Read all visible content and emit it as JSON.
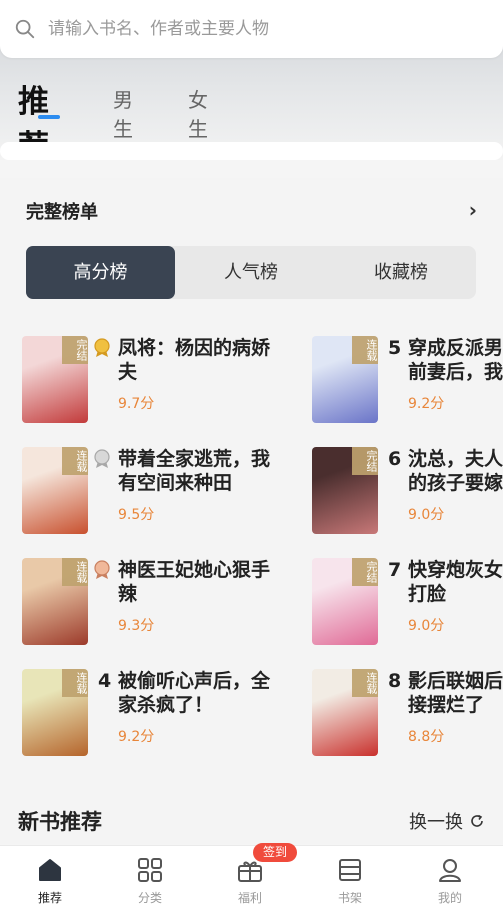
{
  "search": {
    "placeholder": "请输入书名、作者或主要人物"
  },
  "top_tabs": [
    "推荐",
    "男生",
    "女生"
  ],
  "ranking": {
    "title": "完整榜单",
    "segments": [
      "高分榜",
      "人气榜",
      "收藏榜"
    ],
    "books": [
      {
        "rank": "1",
        "title": "凤将：杨因的病娇\n夫",
        "score": "9.7分",
        "status": "完结",
        "medal": "gold",
        "cover_colors": [
          "#f3d7d7",
          "#c23a3a"
        ]
      },
      {
        "rank": "2",
        "title": "带着全家逃荒，我\n有空间来种田",
        "score": "9.5分",
        "status": "连载",
        "medal": "silver",
        "cover_colors": [
          "#f5e6dc",
          "#c8502e"
        ]
      },
      {
        "rank": "3",
        "title": "神医王妃她心狠手\n辣",
        "score": "9.3分",
        "status": "连载",
        "medal": "bronze",
        "cover_colors": [
          "#e9c9a8",
          "#9c3a2a"
        ]
      },
      {
        "rank": "4",
        "title": "被偷听心声后，全\n家杀疯了！",
        "score": "9.2分",
        "status": "连载",
        "medal": "",
        "cover_colors": [
          "#e8e5b8",
          "#b5642b"
        ]
      },
      {
        "rank": "5",
        "title": "穿成反派男\n前妻后，我",
        "score": "9.2分",
        "status": "连载",
        "medal": "",
        "cover_colors": [
          "#dfe6f5",
          "#6a74c8"
        ]
      },
      {
        "rank": "6",
        "title": "沈总，夫人\n的孩子要嫁",
        "score": "9.0分",
        "status": "完结",
        "medal": "",
        "cover_colors": [
          "#4a2e2e",
          "#c87878"
        ]
      },
      {
        "rank": "7",
        "title": "快穿炮灰女\n打脸",
        "score": "9.0分",
        "status": "完结",
        "medal": "",
        "cover_colors": [
          "#f7e4ec",
          "#e06a96"
        ]
      },
      {
        "rank": "8",
        "title": "影后联姻后\n接摆烂了",
        "score": "8.8分",
        "status": "连载",
        "medal": "",
        "cover_colors": [
          "#f2ece4",
          "#c9302c"
        ]
      }
    ]
  },
  "new_books": {
    "title": "新书推荐",
    "swap_label": "换一换"
  },
  "bottom_nav": [
    {
      "label": "推荐",
      "icon": "home-icon"
    },
    {
      "label": "分类",
      "icon": "grid-icon"
    },
    {
      "label": "福利",
      "icon": "gift-icon"
    },
    {
      "label": "书架",
      "icon": "bookshelf-icon"
    },
    {
      "label": "我的",
      "icon": "user-icon"
    }
  ],
  "signin_badge": "签到",
  "colors": {
    "accent": "#2c8cf0",
    "segment_active": "#3a4452",
    "score": "#e8863a",
    "badge": "#f04b3c"
  }
}
